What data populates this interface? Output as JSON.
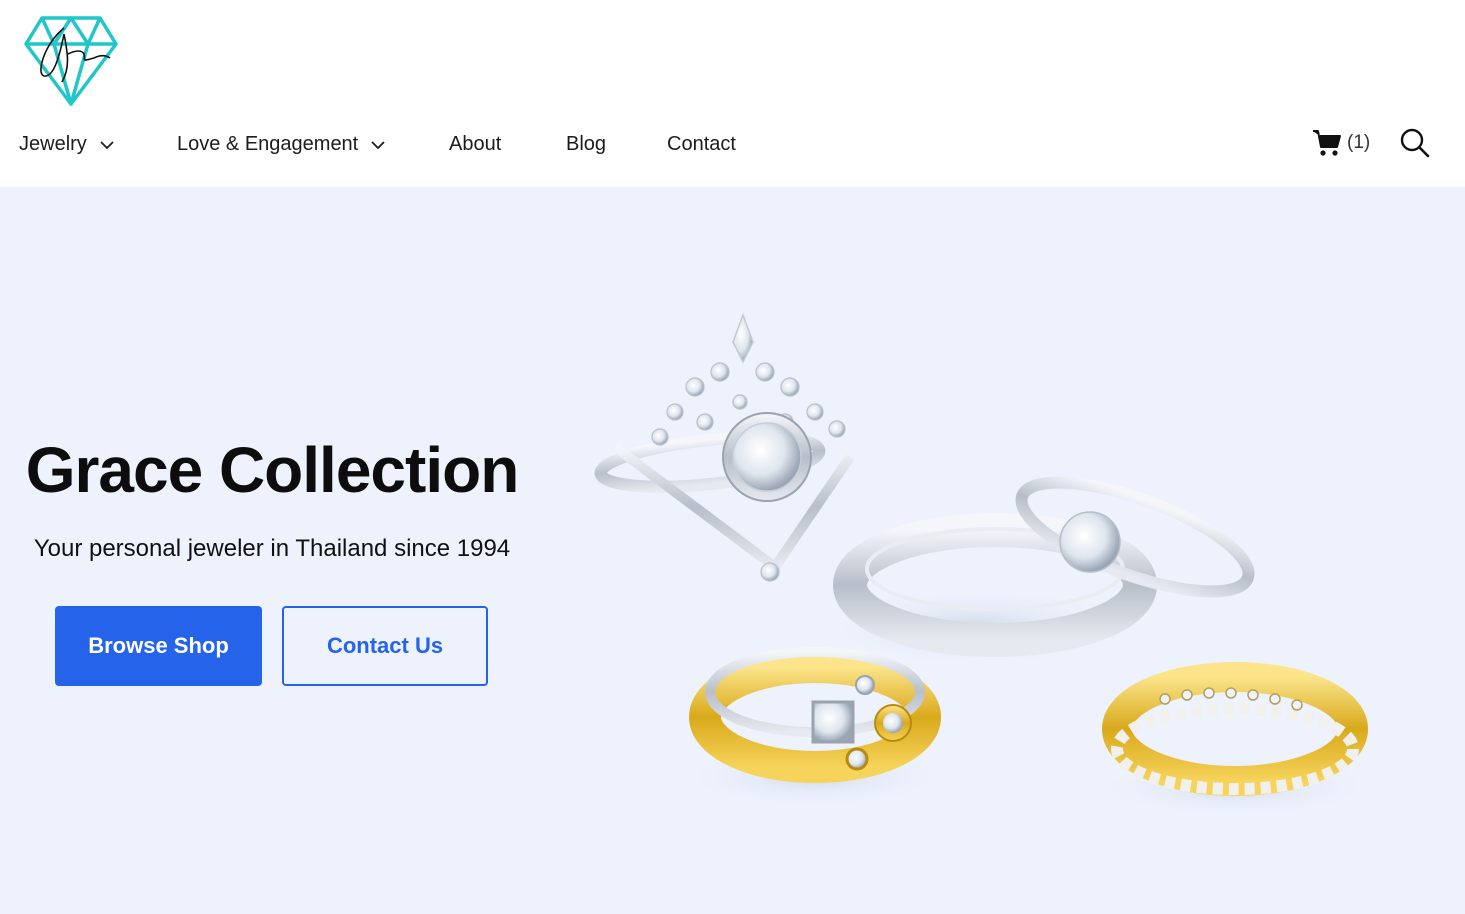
{
  "brand": {
    "logo_text": "Grace",
    "logo_icon": "diamond-logo-icon",
    "accent_color": "#1fc7c9"
  },
  "nav": {
    "items": [
      {
        "label": "Jewelry",
        "has_dropdown": true,
        "icon": "chevron-down-icon"
      },
      {
        "label": "Love & Engagement",
        "has_dropdown": true,
        "icon": "chevron-down-icon"
      },
      {
        "label": "About",
        "has_dropdown": false
      },
      {
        "label": "Blog",
        "has_dropdown": false
      },
      {
        "label": "Contact",
        "has_dropdown": false
      }
    ]
  },
  "cart": {
    "icon": "cart-icon",
    "count_label": "(1)"
  },
  "search": {
    "icon": "search-icon"
  },
  "hero": {
    "title": "Grace Collection",
    "subtitle": "Your personal jeweler in Thailand since 1994",
    "primary_button": "Browse Shop",
    "secondary_button": "Contact Us",
    "image": "rings-photo",
    "background_color": "#edf2fd",
    "button_color": "#2563eb"
  }
}
